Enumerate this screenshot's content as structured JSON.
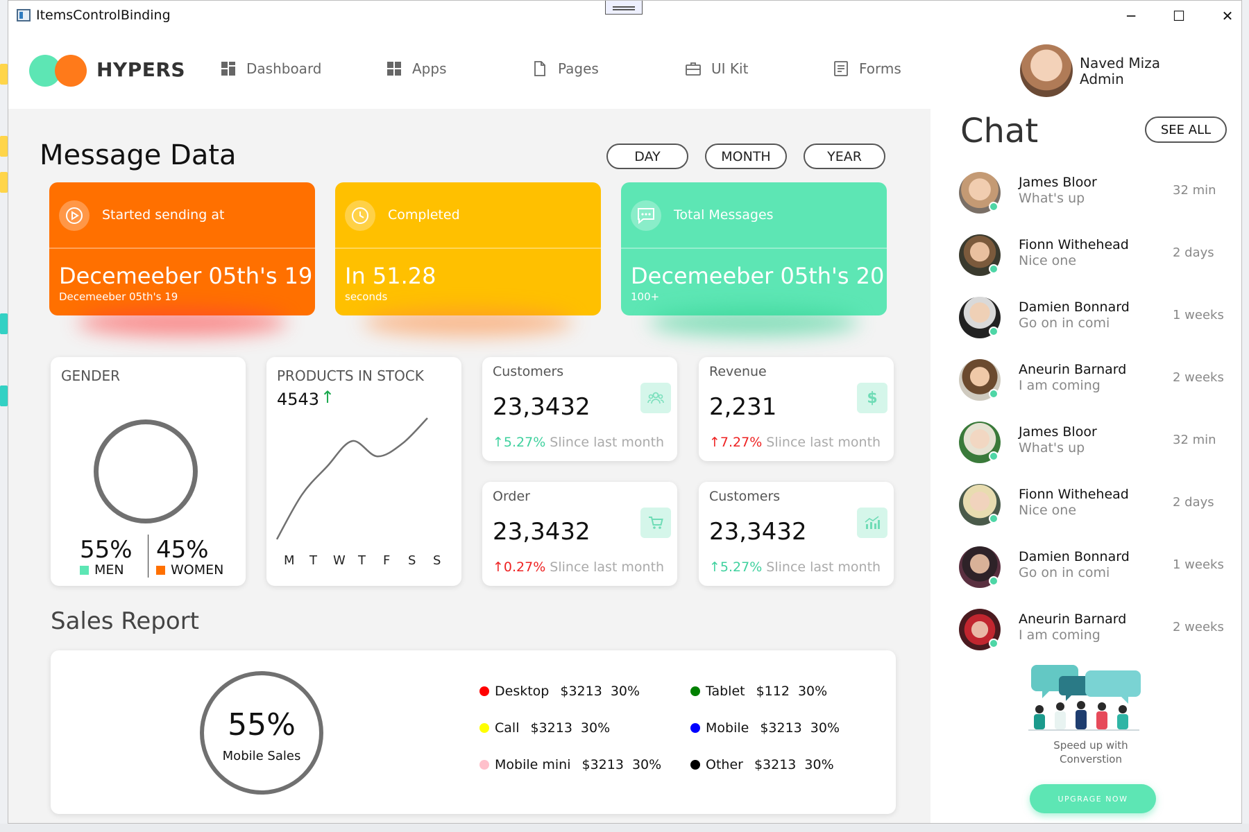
{
  "window": {
    "title": "ItemsControlBinding",
    "controls": {
      "minimize": "─",
      "maximize": "☐",
      "close": "✕"
    }
  },
  "brand": {
    "name": "HYPERS",
    "colors": {
      "green": "#5de6b4",
      "orange": "#ff7a1a"
    }
  },
  "nav": [
    {
      "label": "Dashboard",
      "icon": "dashboard-icon"
    },
    {
      "label": "Apps",
      "icon": "apps-icon"
    },
    {
      "label": "Pages",
      "icon": "pages-icon"
    },
    {
      "label": "UI Kit",
      "icon": "briefcase-icon"
    },
    {
      "label": "Forms",
      "icon": "forms-icon"
    }
  ],
  "user": {
    "name": "Naved Miza",
    "role": "Admin"
  },
  "message_data": {
    "title": "Message Data",
    "periods": [
      "DAY",
      "MONTH",
      "YEAR"
    ],
    "cards": [
      {
        "label": "Started sending at",
        "value": "Decemeeber 05th's 19",
        "sub": "Decemeeber 05th's 19",
        "icon": "play-icon",
        "color": "#ff7000"
      },
      {
        "label": "Completed",
        "value": "In 51.28",
        "sub": "seconds",
        "icon": "clock-icon",
        "color": "#ffc000"
      },
      {
        "label": "Total Messages",
        "value": "Decemeeber 05th's 20",
        "sub": "100+",
        "icon": "chat-bubble-icon",
        "color": "#5de6b4"
      }
    ]
  },
  "gender": {
    "title": "GENDER",
    "men_pct": "55%",
    "men_label": "MEN",
    "women_pct": "45%",
    "women_label": "WOMEN"
  },
  "stock": {
    "title": "PRODUCTS IN STOCK",
    "value": "4543",
    "trend_icon": "↑",
    "days": [
      "M",
      "T",
      "W",
      "T",
      "F",
      "S",
      "S"
    ]
  },
  "stats": [
    {
      "title": "Customers",
      "value": "23,3432",
      "arrow": "↑",
      "delta": "5.27%",
      "since": "Slince last month",
      "trend": "up",
      "icon": "users-icon"
    },
    {
      "title": "Revenue",
      "value": "2,231",
      "arrow": "↑",
      "delta": "7.27%",
      "since": "Slince last month",
      "trend": "down",
      "icon": "dollar-icon"
    },
    {
      "title": "Order",
      "value": "23,3432",
      "arrow": "↑",
      "delta": "0.27%",
      "since": "Slince last month",
      "trend": "down",
      "icon": "cart-icon"
    },
    {
      "title": "Customers",
      "value": "23,3432",
      "arrow": "↑",
      "delta": "5.27%",
      "since": "Slince last month",
      "trend": "up",
      "icon": "bar-chart-icon"
    }
  ],
  "sales": {
    "title": "Sales Report",
    "pct": "55%",
    "label": "Mobile Sales",
    "legend": [
      {
        "name": "Desktop",
        "amount": "$3213",
        "pct": "30%",
        "color": "#ff0000"
      },
      {
        "name": "Tablet",
        "amount": "$112",
        "pct": "30%",
        "color": "#008000"
      },
      {
        "name": "Call",
        "amount": "$3213",
        "pct": "30%",
        "color": "#ffff00"
      },
      {
        "name": "Mobile",
        "amount": "$3213",
        "pct": "30%",
        "color": "#0000ff"
      },
      {
        "name": "Mobile mini",
        "amount": "$3213",
        "pct": "30%",
        "color": "#ffc0cb"
      },
      {
        "name": "Other",
        "amount": "$3213",
        "pct": "30%",
        "color": "#000000"
      }
    ]
  },
  "chat": {
    "title": "Chat",
    "see_all": "SEE ALL",
    "items": [
      {
        "name": "James Bloor",
        "message": "What's up",
        "time": "32 min"
      },
      {
        "name": "Fionn Withehead",
        "message": "Nice one",
        "time": "2 days"
      },
      {
        "name": "Damien Bonnard",
        "message": "Go on in comi",
        "time": "1 weeks"
      },
      {
        "name": "Aneurin Barnard",
        "message": "I am coming",
        "time": "2 weeks"
      },
      {
        "name": "James Bloor",
        "message": "What's up",
        "time": "32 min"
      },
      {
        "name": "Fionn Withehead",
        "message": "Nice one",
        "time": "2 days"
      },
      {
        "name": "Damien Bonnard",
        "message": "Go on in comi",
        "time": "1 weeks"
      },
      {
        "name": "Aneurin Barnard",
        "message": "I am coming",
        "time": "2 weeks"
      }
    ],
    "promo_line1": "Speed up with",
    "promo_line2": "Converstion",
    "upgrade": "UPGRAGE NOW"
  },
  "chart_data": [
    {
      "type": "line",
      "title": "PRODUCTS IN STOCK",
      "categories": [
        "M",
        "T",
        "W",
        "T",
        "F",
        "S",
        "S"
      ],
      "values": [
        5,
        40,
        62,
        82,
        70,
        80,
        100
      ],
      "ylim": [
        0,
        100
      ]
    },
    {
      "type": "pie",
      "title": "GENDER",
      "categories": [
        "MEN",
        "WOMEN"
      ],
      "values": [
        55,
        45
      ]
    },
    {
      "type": "pie",
      "title": "Sales Report",
      "categories": [
        "Desktop",
        "Tablet",
        "Call",
        "Mobile",
        "Mobile mini",
        "Other"
      ],
      "values": [
        30,
        30,
        30,
        30,
        30,
        30
      ]
    }
  ]
}
